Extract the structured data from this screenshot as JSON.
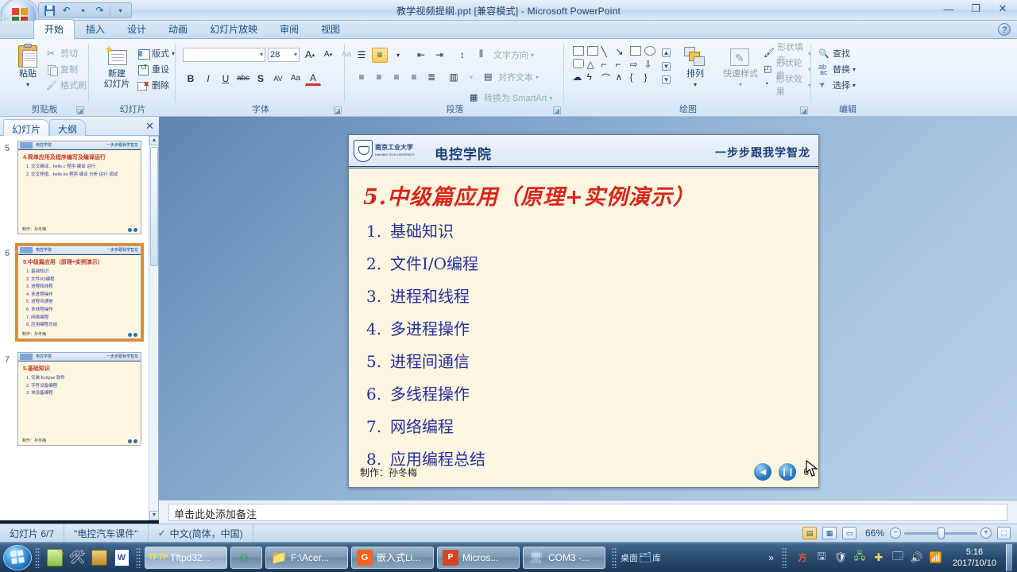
{
  "window": {
    "title": "教学视频提纲.ppt [兼容模式] - Microsoft PowerPoint",
    "minimize": "—",
    "restore": "❐",
    "close": "✕",
    "help": "?"
  },
  "quick_access": {
    "save": "save-icon",
    "undo": "↶",
    "redo": "↷",
    "more": "▾"
  },
  "ribbon": {
    "tabs": [
      {
        "label": "开始",
        "active": true
      },
      {
        "label": "插入",
        "active": false
      },
      {
        "label": "设计",
        "active": false
      },
      {
        "label": "动画",
        "active": false
      },
      {
        "label": "幻灯片放映",
        "active": false
      },
      {
        "label": "审阅",
        "active": false
      },
      {
        "label": "视图",
        "active": false
      }
    ],
    "groups": {
      "clipboard": {
        "name": "剪贴板",
        "paste": "粘贴",
        "paste_caret": "▾",
        "cut": "剪切",
        "copy": "复制",
        "format_painter": "格式刷"
      },
      "slides": {
        "name": "幻灯片",
        "new_slide_line1": "新建",
        "new_slide_line2": "幻灯片",
        "new_slide_caret": "▾",
        "layout": "版式",
        "reset": "重设",
        "delete": "删除",
        "caret": "▾"
      },
      "font": {
        "name": "字体",
        "font_name": "",
        "font_size": "28",
        "grow": "A",
        "shrink": "A",
        "clear_format": "Aa",
        "bold": "B",
        "italic": "I",
        "underline": "U",
        "strike": "abc",
        "shadow": "S",
        "spacing": "AV",
        "case": "Aa",
        "font_color": "A",
        "caret": "▾"
      },
      "paragraph": {
        "name": "段落",
        "text_direction": "文字方向",
        "align_text": "对齐文本",
        "smartart": "转换为 SmartArt",
        "caret": "▾"
      },
      "drawing": {
        "name": "绘图",
        "arrange": "排列",
        "quick_styles": "快速样式",
        "shape_fill": "形状填充",
        "shape_outline": "形状轮廓",
        "shape_effects": "形状效果",
        "caret": "▾"
      },
      "editing": {
        "name": "编辑",
        "find": "查找",
        "replace": "替换",
        "select": "选择",
        "caret": "▾"
      }
    }
  },
  "left_pane": {
    "tab_slides": "幻灯片",
    "tab_outline": "大纲",
    "close": "✕",
    "scroll_up": "▲",
    "scroll_down": "▼",
    "thumbnails": [
      {
        "number": "5",
        "selected": false,
        "header_left": "电控学院",
        "header_right": "一步步跟我学智龙",
        "title": "4.简单应用及程序编写及编译运行",
        "items": [
          "1. 交叉编译、hello.c 程序 编译 运行",
          "2. 交叉移植、hello.ko 程序 编译 分析 运行 调试"
        ],
        "footer": "制作：孙冬梅"
      },
      {
        "number": "6",
        "selected": true,
        "header_left": "电控学院",
        "header_right": "一步步跟我学智龙",
        "title": "5.中级篇应用（原理+实例演示）",
        "items": [
          "1. 基础知识",
          "2. 文件I/O编程",
          "3. 进程和线程",
          "4. 多进程操作",
          "5. 进程间通信",
          "6. 多线程操作",
          "7. 网络编程",
          "8. 应用编程总结"
        ],
        "footer": "制作：孙冬梅"
      },
      {
        "number": "7",
        "selected": false,
        "header_left": "电控学院",
        "header_right": "一步步跟我学智龙",
        "title": "5.基础知识",
        "items": [
          "1. 安装 Eclipse 软件",
          "2. 字符设备编程",
          "3. 块设备编程"
        ],
        "footer": "制作：孙冬梅"
      }
    ]
  },
  "slide": {
    "header_left": "电控学院",
    "header_right": "一步步跟我学智龙",
    "university": "南京工业大学",
    "university_en": "NANJING TECH UNIVERSITY",
    "title": "5.中级篇应用（原理+实例演示）",
    "items": [
      {
        "num": "1.",
        "text": "基础知识"
      },
      {
        "num": "2.",
        "text": "文件I/O编程"
      },
      {
        "num": "3.",
        "text": "进程和线程"
      },
      {
        "num": "4.",
        "text": "多进程操作"
      },
      {
        "num": "5.",
        "text": "进程间通信"
      },
      {
        "num": "6.",
        "text": "多线程操作"
      },
      {
        "num": "7.",
        "text": "网络编程"
      },
      {
        "num": "8.",
        "text": "应用编程总结"
      }
    ],
    "footer_author": "制作：孙冬梅",
    "nav_back": "◀",
    "nav_pause": "❙❙",
    "page_number": "6"
  },
  "notes": {
    "placeholder": "单击此处添加备注",
    "value": ""
  },
  "status_bar": {
    "slide_count": "幻灯片 6/7",
    "theme": "\"电控汽车课件\"",
    "language": "中文(简体，中国)",
    "zoom_level": "66%",
    "zoom_out": "−",
    "zoom_in": "+",
    "view_normal": "▤",
    "view_sorter": "▦",
    "view_show": "▭",
    "fit_window": "⛶"
  },
  "taskbar": {
    "start": "start-orb",
    "quick_launch": [
      "notepad-icon",
      "tools-icon",
      "security-icon",
      "word-icon"
    ],
    "tasks": [
      {
        "label": "Tftpd32...",
        "icon": "tftp-icon",
        "active": true
      },
      {
        "label": "",
        "icon": "browser-icon",
        "active": false
      },
      {
        "label": "F:\\Acer...",
        "icon": "folder-icon",
        "active": false
      },
      {
        "label": "嵌入式Li...",
        "icon": "pdf-icon",
        "active": false
      },
      {
        "label": "Micros...",
        "icon": "powerpoint-icon",
        "active": false
      },
      {
        "label": "COM3 -...",
        "icon": "serial-icon",
        "active": false
      }
    ],
    "toolbar_labels": [
      "桌面",
      "库"
    ],
    "tray_overflow": "»",
    "tray_icons": [
      "ime-icon",
      "sync-icon",
      "shield-icon",
      "network-icon",
      "update-icon",
      "devices-icon",
      "volume-icon",
      "signal-icon"
    ],
    "time": "5:16",
    "date": "2017/10/10"
  }
}
